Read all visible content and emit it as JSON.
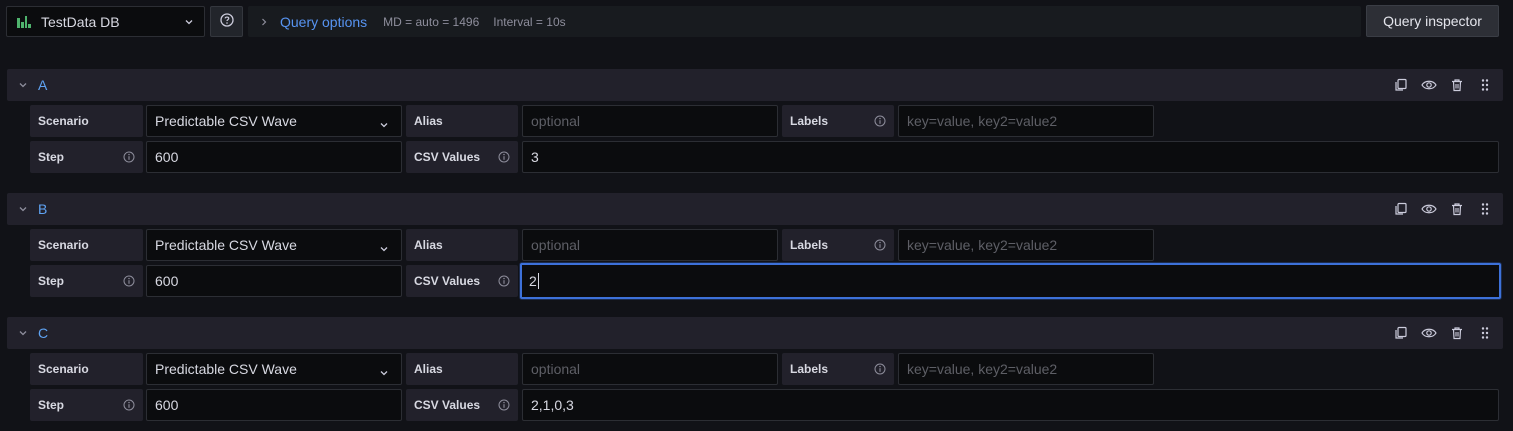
{
  "datasource": {
    "name": "TestData DB"
  },
  "query_options": {
    "title": "Query options",
    "md": "MD = auto = 1496",
    "interval": "Interval = 10s"
  },
  "inspector": {
    "label": "Query inspector"
  },
  "labels": {
    "scenario": "Scenario",
    "alias": "Alias",
    "labels": "Labels",
    "step": "Step",
    "csv_values": "CSV Values"
  },
  "placeholders": {
    "alias": "optional",
    "labels": "key=value, key2=value2"
  },
  "queries": [
    {
      "name": "A",
      "scenario": "Predictable CSV Wave",
      "step": "600",
      "csv_values": "3"
    },
    {
      "name": "B",
      "scenario": "Predictable CSV Wave",
      "step": "600",
      "csv_values": "2"
    },
    {
      "name": "C",
      "scenario": "Predictable CSV Wave",
      "step": "600",
      "csv_values": "2,1,0,3"
    }
  ],
  "colors": {
    "accent": "#5794f2",
    "focus": "#3d71d9",
    "ds_logo": "#4fb36d"
  },
  "icons": {
    "datasource": "testdata-logo-icon",
    "help": "question-circle-icon",
    "expand": "chevron-right-icon",
    "collapse": "chevron-down-icon",
    "duplicate": "copy-icon",
    "toggle": "eye-icon",
    "remove": "trash-icon",
    "drag": "drag-handle-icon",
    "info": "info-circle-icon"
  }
}
